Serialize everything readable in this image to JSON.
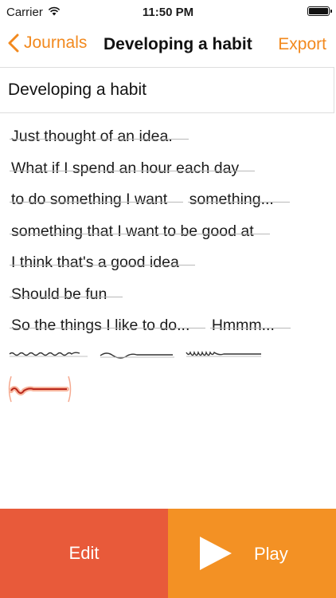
{
  "status_bar": {
    "carrier": "Carrier",
    "time": "11:50 PM"
  },
  "nav": {
    "back_label": "Journals",
    "title": "Developing a habit",
    "export_label": "Export"
  },
  "title_field": {
    "value": "Developing a habit"
  },
  "lines": [
    [
      "Just thought of an idea."
    ],
    [
      "What if I spend an hour each day"
    ],
    [
      "to do something I want",
      "something..."
    ],
    [
      "something that I want to be good at"
    ],
    [
      "I think that's a good idea"
    ],
    [
      "Should be fun"
    ],
    [
      "So the things I like to do...",
      "Hmmm..."
    ]
  ],
  "buttons": {
    "edit_label": "Edit",
    "play_label": "Play"
  },
  "colors": {
    "accent": "#f2891e",
    "edit_bg": "#e85a3a",
    "play_bg": "#f39124",
    "squiggle_selected": "#e0432a"
  }
}
